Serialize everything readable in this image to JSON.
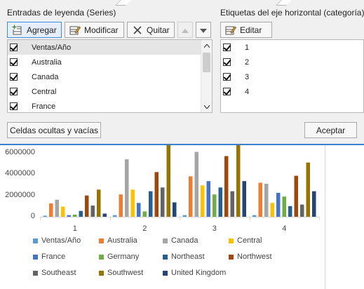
{
  "dialog": {
    "series_section": {
      "title": "Entradas de leyenda (Series)",
      "buttons": {
        "add": "Agregar",
        "edit": "Modificar",
        "remove": "Quitar"
      },
      "items": [
        {
          "label": "Ventas/Año",
          "checked": true,
          "selected": true
        },
        {
          "label": "Australia",
          "checked": true,
          "selected": false
        },
        {
          "label": "Canada",
          "checked": true,
          "selected": false
        },
        {
          "label": "Central",
          "checked": true,
          "selected": false
        },
        {
          "label": "France",
          "checked": true,
          "selected": false
        }
      ]
    },
    "category_section": {
      "title": "Etiquetas del eje horizontal (categoría)",
      "edit_button": "Editar",
      "items": [
        {
          "label": "1",
          "checked": true
        },
        {
          "label": "2",
          "checked": true
        },
        {
          "label": "3",
          "checked": true
        },
        {
          "label": "4",
          "checked": true
        }
      ]
    },
    "hidden_cells_button": "Celdas ocultas y vacías",
    "ok_button": "Aceptar"
  },
  "chart_data": {
    "type": "bar",
    "categories": [
      "1",
      "2",
      "3",
      "4"
    ],
    "y_ticks": [
      "0",
      "2000000",
      "4000000",
      "6000000"
    ],
    "ylim": [
      0,
      7600000
    ],
    "series": [
      {
        "name": "Ventas/Año",
        "color": "#5b9bd5",
        "values": [
          100000,
          150000,
          150000,
          150000
        ]
      },
      {
        "name": "Australia",
        "color": "#ed7d31",
        "values": [
          1250000,
          2100000,
          3800000,
          3200000
        ]
      },
      {
        "name": "Canada",
        "color": "#a5a5a5",
        "values": [
          1600000,
          5400000,
          6100000,
          3100000
        ]
      },
      {
        "name": "Central",
        "color": "#ffc000",
        "values": [
          950000,
          2550000,
          2950000,
          1300000
        ]
      },
      {
        "name": "France",
        "color": "#4472c4",
        "values": [
          150000,
          1300000,
          3350000,
          2250000
        ]
      },
      {
        "name": "Germany",
        "color": "#70ad47",
        "values": [
          200000,
          500000,
          2100000,
          1900000
        ]
      },
      {
        "name": "Northeast",
        "color": "#255e91",
        "values": [
          550000,
          2400000,
          2750000,
          1000000
        ]
      },
      {
        "name": "Northwest",
        "color": "#9e480e",
        "values": [
          2000000,
          4200000,
          5700000,
          3850000
        ]
      },
      {
        "name": "Southeast",
        "color": "#636363",
        "values": [
          1050000,
          2750000,
          2400000,
          1150000
        ]
      },
      {
        "name": "Southwest",
        "color": "#997300",
        "values": [
          2550000,
          7600000,
          7600000,
          5100000
        ]
      },
      {
        "name": "United Kingdom",
        "color": "#264478",
        "values": [
          300000,
          1350000,
          3350000,
          2400000
        ]
      }
    ]
  }
}
